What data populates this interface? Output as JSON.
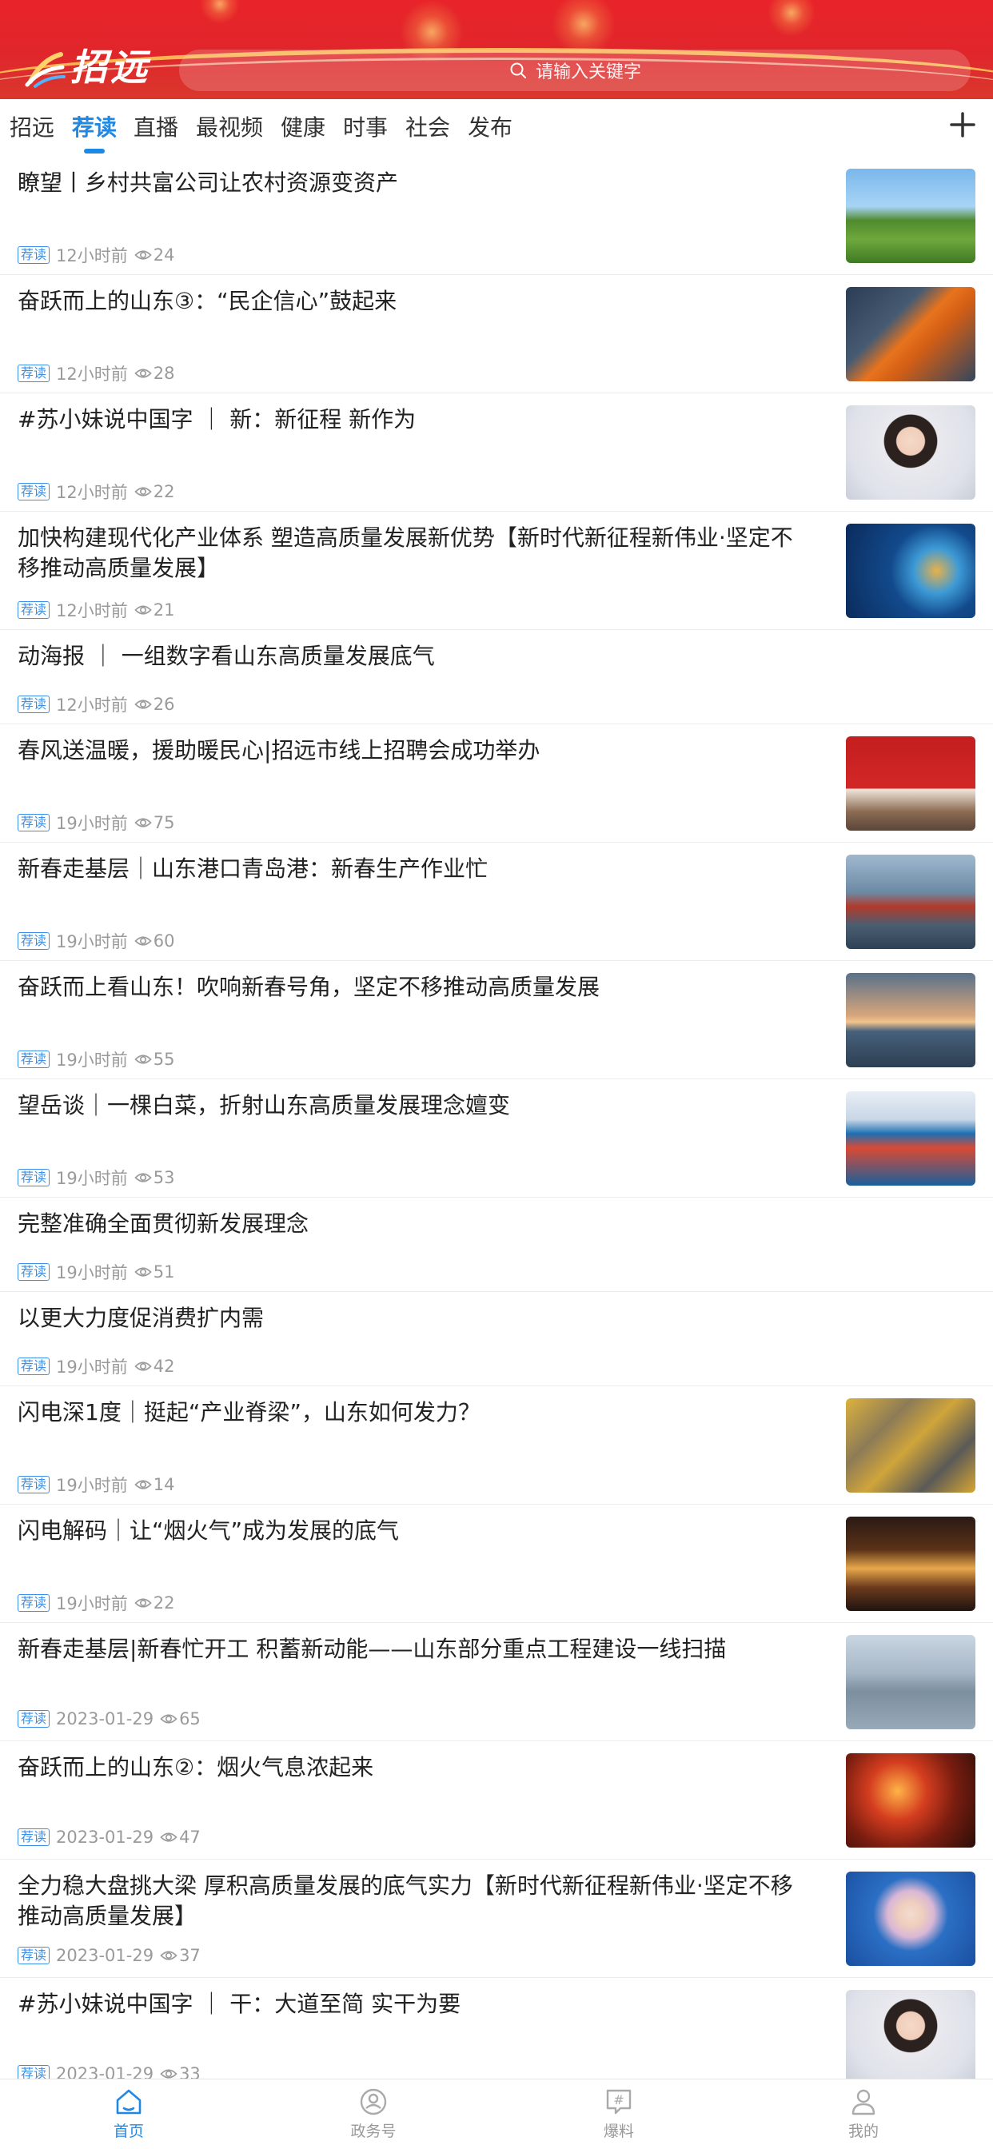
{
  "app": {
    "logo_text": "招远",
    "search_placeholder": "请输入关键字"
  },
  "tabs": [
    {
      "label": "招远"
    },
    {
      "label": "荐读",
      "active": true
    },
    {
      "label": "直播"
    },
    {
      "label": "最视频"
    },
    {
      "label": "健康"
    },
    {
      "label": "时事"
    },
    {
      "label": "社会"
    },
    {
      "label": "发布"
    }
  ],
  "tab_add_icon": "plus-icon",
  "articles": [
    {
      "title": "瞭望丨乡村共富公司让农村资源变资产",
      "tag": "荐读",
      "time": "12小时前",
      "views": "24",
      "thumbnail": "farmland-photo"
    },
    {
      "title": "奋跃而上的山东③：“民企信心”鼓起来",
      "tag": "荐读",
      "time": "12小时前",
      "views": "28",
      "thumbnail": "robot-arm-factory-photo"
    },
    {
      "title": "#苏小妹说中国字 ｜ 新：新征程  新作为",
      "tag": "荐读",
      "time": "12小时前",
      "views": "22",
      "thumbnail": "presenter-portrait-photo"
    },
    {
      "title": "加快构建现代化产业体系  塑造高质量发展新优势【新时代新征程新伟业·坚定不移推动高质量发展】",
      "tag": "荐读",
      "time": "12小时前",
      "views": "21",
      "thumbnail": "news-anchor-globe-photo"
    },
    {
      "title": "动海报 ｜ 一组数字看山东高质量发展底气",
      "tag": "荐读",
      "time": "12小时前",
      "views": "26",
      "thumbnail": null
    },
    {
      "title": "春风送温暖，援助暖民心|招远市线上招聘会成功举办",
      "tag": "荐读",
      "time": "19小时前",
      "views": "75",
      "thumbnail": "meeting-banner-photo"
    },
    {
      "title": "新春走基层｜山东港口青岛港：新春生产作业忙",
      "tag": "荐读",
      "time": "19小时前",
      "views": "60",
      "thumbnail": "port-cranes-photo"
    },
    {
      "title": "奋跃而上看山东！吹响新春号角，坚定不移推动高质量发展",
      "tag": "荐读",
      "time": "19小时前",
      "views": "55",
      "thumbnail": "sunrise-coast-photo"
    },
    {
      "title": "望岳谈｜一棵白菜，折射山东高质量发展理念嬗变",
      "tag": "荐读",
      "time": "19小时前",
      "views": "53",
      "thumbnail": "harbor-aerial-photo"
    },
    {
      "title": "完整准确全面贯彻新发展理念",
      "tag": "荐读",
      "time": "19小时前",
      "views": "51",
      "thumbnail": null
    },
    {
      "title": "以更大力度促消费扩内需",
      "tag": "荐读",
      "time": "19小时前",
      "views": "42",
      "thumbnail": null
    },
    {
      "title": "闪电深1度｜挺起“产业脊梁”，山东如何发力？",
      "tag": "荐读",
      "time": "19小时前",
      "views": "14",
      "thumbnail": "assembly-line-photo"
    },
    {
      "title": "闪电解码｜让“烟火气”成为发展的底气",
      "tag": "荐读",
      "time": "19小时前",
      "views": "22",
      "thumbnail": "night-market-poster"
    },
    {
      "title": "新春走基层|新春忙开工  积蓄新动能——山东部分重点工程建设一线扫描",
      "tag": "荐读",
      "time": "2023-01-29",
      "views": "65",
      "thumbnail": "construction-site-aerial-photo"
    },
    {
      "title": "奋跃而上的山东②：烟火气息浓起来",
      "tag": "荐读",
      "time": "2023-01-29",
      "views": "47",
      "thumbnail": "lantern-street-photo"
    },
    {
      "title": "全力稳大盘挑大梁  厚积高质量发展的底气实力【新时代新征程新伟业·坚定不移推动高质量发展】",
      "tag": "荐读",
      "time": "2023-01-29",
      "views": "37",
      "thumbnail": "news-presenter-photo"
    },
    {
      "title": "#苏小妹说中国字 ｜ 干：大道至简  实干为要",
      "tag": "荐读",
      "time": "2023-01-29",
      "views": "33",
      "thumbnail": "presenter-portrait-photo"
    }
  ],
  "bottom_nav": [
    {
      "label": "首页",
      "icon": "home-icon",
      "active": true
    },
    {
      "label": "政务号",
      "icon": "government-account-icon"
    },
    {
      "label": "爆料",
      "icon": "tip-off-icon"
    },
    {
      "label": "我的",
      "icon": "profile-icon"
    }
  ],
  "colors": {
    "brand_red": "#e0262b",
    "accent_blue": "#1e88e5",
    "meta_gray": "#9a9a9a"
  }
}
